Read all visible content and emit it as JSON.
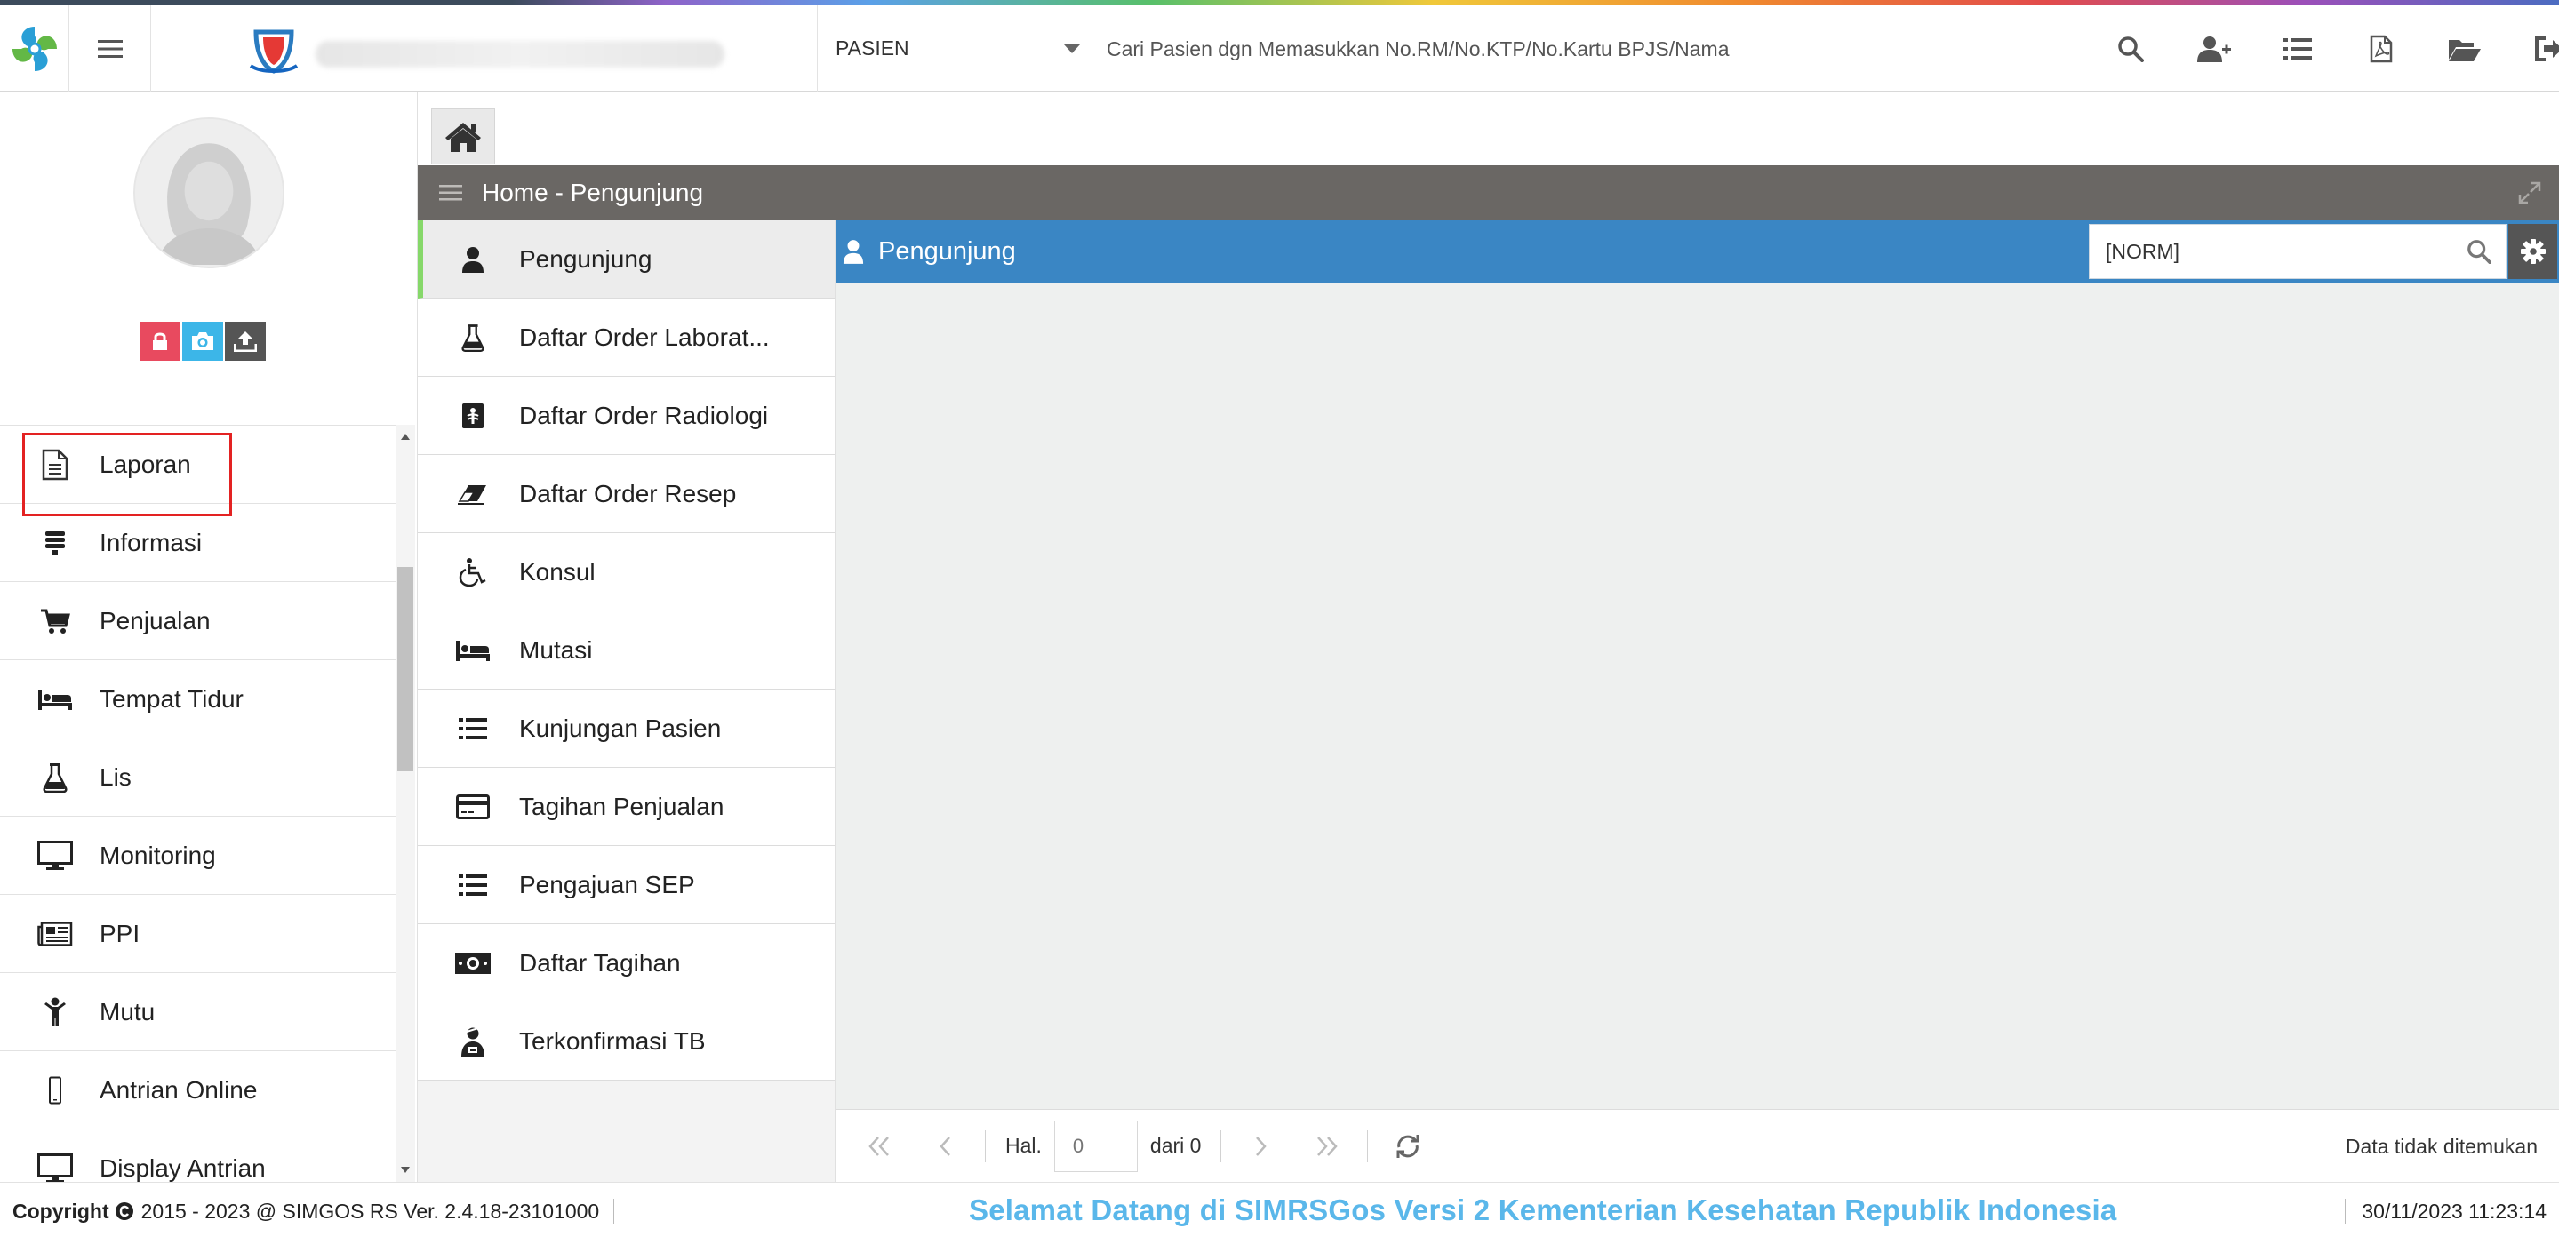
{
  "colors": {
    "accent": "#3a86c4",
    "panel_header": "#6a6764",
    "active_marker": "#86d86a",
    "marquee": "#5ab7ea",
    "highlight_box": "#e32222"
  },
  "header": {
    "search_mode": "PASIEN",
    "search_placeholder": "Cari Pasien dgn Memasukkan No.RM/No.KTP/No.Kartu BPJS/Nama",
    "icons": [
      "search-icon",
      "add-user-icon",
      "list-icon",
      "pdf-file-icon",
      "folder-open-icon",
      "sign-out-icon"
    ]
  },
  "sidebar": {
    "items": [
      {
        "label": "Laporan",
        "icon": "file-text-icon",
        "highlighted": true
      },
      {
        "label": "Informasi",
        "icon": "database-icon"
      },
      {
        "label": "Penjualan",
        "icon": "cart-plus-icon"
      },
      {
        "label": "Tempat Tidur",
        "icon": "bed-icon"
      },
      {
        "label": "Lis",
        "icon": "flask-icon"
      },
      {
        "label": "Monitoring",
        "icon": "desktop-icon"
      },
      {
        "label": "PPI",
        "icon": "newspaper-icon"
      },
      {
        "label": "Mutu",
        "icon": "child-icon"
      },
      {
        "label": "Antrian Online",
        "icon": "mobile-icon"
      },
      {
        "label": "Display Antrian",
        "icon": "desktop-icon"
      }
    ]
  },
  "panel": {
    "title": "Home - Pengunjung",
    "submenu": [
      {
        "label": "Pengunjung",
        "icon": "user-icon",
        "active": true
      },
      {
        "label": "Daftar Order Laborat...",
        "icon": "flask-icon"
      },
      {
        "label": "Daftar Order Radiologi",
        "icon": "x-ray-icon"
      },
      {
        "label": "Daftar Order Resep",
        "icon": "eraser-icon"
      },
      {
        "label": "Konsul",
        "icon": "wheelchair-icon"
      },
      {
        "label": "Mutasi",
        "icon": "bed-icon"
      },
      {
        "label": "Kunjungan Pasien",
        "icon": "list-icon"
      },
      {
        "label": "Tagihan Penjualan",
        "icon": "credit-card-icon"
      },
      {
        "label": "Pengajuan SEP",
        "icon": "list-icon"
      },
      {
        "label": "Daftar Tagihan",
        "icon": "money-icon"
      },
      {
        "label": "Terkonfirmasi TB",
        "icon": "user-injured-icon"
      }
    ],
    "content_title": "Pengunjung",
    "norm_placeholder": "[NORM]",
    "pager": {
      "hal_label": "Hal.",
      "page_value": "0",
      "of_label": "dari 0",
      "empty_text": "Data tidak ditemukan"
    }
  },
  "footer": {
    "copyright_label": "Copyright",
    "copyright_text": "2015 - 2023 @ SIMGOS RS Ver. 2.4.18-23101000",
    "marquee": "Selamat Datang di SIMRSGos Versi 2 Kementerian Kesehatan Republik Indonesia",
    "datetime": "30/11/2023 11:23:14"
  }
}
